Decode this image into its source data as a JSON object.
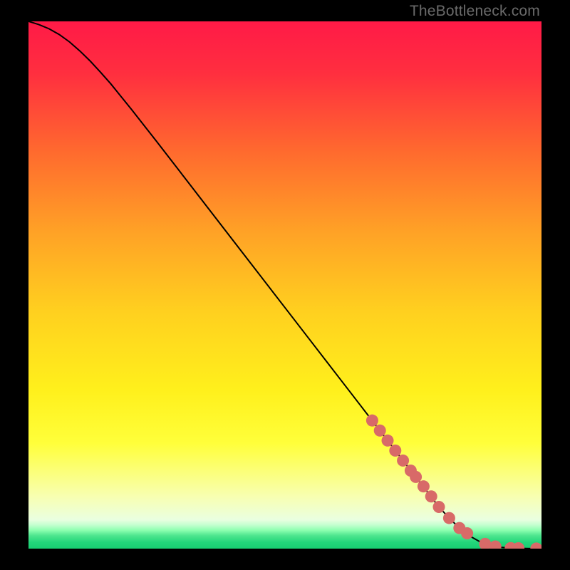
{
  "watermark": "TheBottleneck.com",
  "colors": {
    "gradient_stops": [
      {
        "offset": 0.0,
        "color": "#ff1a47"
      },
      {
        "offset": 0.1,
        "color": "#ff2f3f"
      },
      {
        "offset": 0.25,
        "color": "#ff6b2e"
      },
      {
        "offset": 0.4,
        "color": "#ffa226"
      },
      {
        "offset": 0.55,
        "color": "#ffd01f"
      },
      {
        "offset": 0.7,
        "color": "#fff01c"
      },
      {
        "offset": 0.8,
        "color": "#ffff3a"
      },
      {
        "offset": 0.9,
        "color": "#f8ffb0"
      },
      {
        "offset": 0.945,
        "color": "#eaffe0"
      },
      {
        "offset": 0.955,
        "color": "#c4ffd0"
      },
      {
        "offset": 0.965,
        "color": "#8effb0"
      },
      {
        "offset": 0.975,
        "color": "#4fe68f"
      },
      {
        "offset": 0.988,
        "color": "#23d67a"
      },
      {
        "offset": 1.0,
        "color": "#18cf72"
      }
    ],
    "curve": "#000000",
    "marker": "#d86a68"
  },
  "chart_data": {
    "type": "line",
    "title": "",
    "xlabel": "",
    "ylabel": "",
    "xlim": [
      0,
      100
    ],
    "ylim": [
      0,
      100
    ],
    "series": [
      {
        "name": "curve",
        "x": [
          0,
          2,
          4,
          6,
          8,
          10,
          12,
          14,
          16,
          18,
          20,
          25,
          30,
          35,
          40,
          45,
          50,
          55,
          60,
          65,
          70,
          75,
          80,
          82,
          84,
          86,
          88,
          90,
          92,
          94,
          96,
          98,
          100
        ],
        "y": [
          100,
          99.4,
          98.6,
          97.5,
          96.1,
          94.4,
          92.5,
          90.4,
          88.2,
          85.8,
          83.4,
          77.2,
          70.9,
          64.6,
          58.3,
          52.0,
          45.7,
          39.4,
          33.1,
          26.8,
          20.5,
          14.2,
          7.9,
          5.8,
          3.9,
          2.4,
          1.3,
          0.6,
          0.25,
          0.1,
          0.05,
          0.02,
          0.0
        ]
      }
    ],
    "markers": {
      "name": "highlighted-points",
      "points": [
        {
          "x": 67.0,
          "y": 24.3
        },
        {
          "x": 68.5,
          "y": 22.4
        },
        {
          "x": 70.0,
          "y": 20.5
        },
        {
          "x": 71.5,
          "y": 18.6
        },
        {
          "x": 73.0,
          "y": 16.7
        },
        {
          "x": 74.5,
          "y": 14.8
        },
        {
          "x": 75.5,
          "y": 13.6
        },
        {
          "x": 77.0,
          "y": 11.8
        },
        {
          "x": 78.5,
          "y": 9.9
        },
        {
          "x": 80.0,
          "y": 7.9
        },
        {
          "x": 82.0,
          "y": 5.8
        },
        {
          "x": 84.0,
          "y": 3.9
        },
        {
          "x": 85.5,
          "y": 2.9
        },
        {
          "x": 89.0,
          "y": 0.9
        },
        {
          "x": 91.0,
          "y": 0.4
        },
        {
          "x": 94.0,
          "y": 0.1
        },
        {
          "x": 95.5,
          "y": 0.07
        },
        {
          "x": 99.0,
          "y": 0.01
        }
      ]
    }
  }
}
